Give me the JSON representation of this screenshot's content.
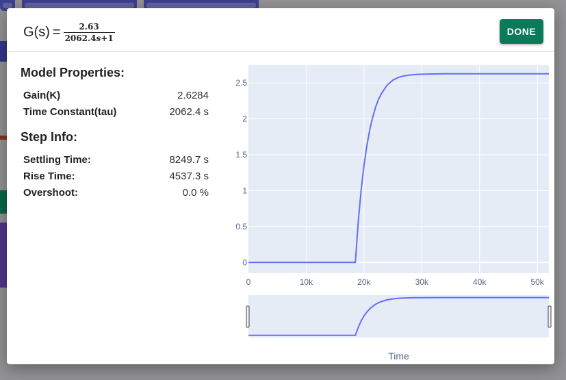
{
  "transfer_function": {
    "lhs": "G(s)",
    "equals": "=",
    "numerator": "2.63",
    "denominator_coef": "2062.4",
    "denominator_var": "s",
    "denominator_rest": "+1"
  },
  "done_label": "DONE",
  "model_properties": {
    "title": "Model Properties:",
    "rows": [
      {
        "label": "Gain(K)",
        "value": "2.6284"
      },
      {
        "label": "Time Constant(tau)",
        "value": "2062.4 s"
      }
    ]
  },
  "step_info": {
    "title": "Step Info:",
    "rows": [
      {
        "label": "Settling Time:",
        "value": "8249.7 s"
      },
      {
        "label": "Rise Time:",
        "value": "4537.3 s"
      },
      {
        "label": "Overshoot:",
        "value": "0.0 %"
      }
    ]
  },
  "colors": {
    "accent": "#0b7a5b",
    "line": "#636efa",
    "plot_bg": "#e5ecf6"
  },
  "chart_data": {
    "type": "line",
    "title": "",
    "xlabel": "Time",
    "ylabel": "",
    "xlim": [
      0,
      52000
    ],
    "ylim": [
      -0.15,
      2.75
    ],
    "x_ticks": [
      0,
      10000,
      20000,
      30000,
      40000,
      50000
    ],
    "x_tick_labels": [
      "0",
      "10k",
      "20k",
      "30k",
      "40k",
      "50k"
    ],
    "y_ticks": [
      0,
      0.5,
      1,
      1.5,
      2,
      2.5
    ],
    "y_tick_labels": [
      "0",
      "0.5",
      "1",
      "1.5",
      "2",
      "2.5"
    ],
    "grid": true,
    "range_slider": true,
    "series": [
      {
        "x": [
          0,
          18500,
          19000,
          19500,
          20000,
          20500,
          21000,
          21500,
          22000,
          22500,
          23000,
          24000,
          25000,
          26000,
          27000,
          28000,
          29000,
          31000,
          34000,
          40000,
          52000
        ],
        "values": [
          0,
          0,
          0.56,
          1.0,
          1.35,
          1.63,
          1.85,
          2.02,
          2.16,
          2.27,
          2.35,
          2.47,
          2.54,
          2.58,
          2.6,
          2.612,
          2.619,
          2.625,
          2.628,
          2.628,
          2.628
        ]
      }
    ]
  }
}
